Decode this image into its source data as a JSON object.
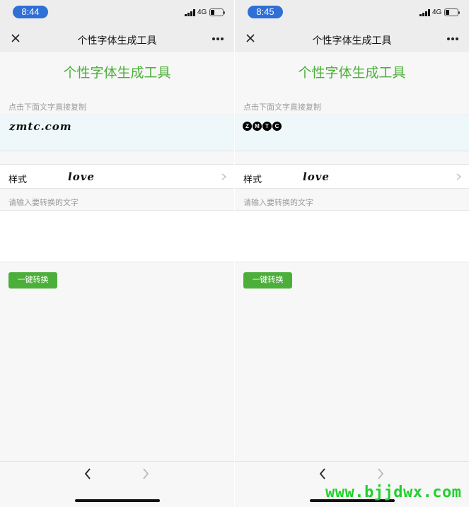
{
  "screens": {
    "left": {
      "time": "8:44",
      "network": "4G",
      "nav_title": "个性字体生成工具",
      "page_title": "个性字体生成工具",
      "copy_hint": "点击下面文字直接复制",
      "result_text": "zmtc.com",
      "style_label": "样式",
      "style_value": "love",
      "input_hint": "请输入要转换的文字",
      "input_value": "",
      "convert_label": "一键转换"
    },
    "right": {
      "time": "8:45",
      "network": "4G",
      "nav_title": "个性字体生成工具",
      "page_title": "个性字体生成工具",
      "copy_hint": "点击下面文字直接复制",
      "result_letters": [
        "Z",
        "M",
        "T",
        "C"
      ],
      "style_label": "样式",
      "style_value": "love",
      "input_hint": "请输入要转换的文字",
      "input_value": "",
      "convert_label": "一键转换"
    }
  },
  "watermark": "www.bjjdwx.com",
  "colors": {
    "accent_green": "#4caf3a",
    "time_pill_blue": "#2f6fd6",
    "result_bg": "#eef7f9",
    "watermark_green": "#22d12c"
  },
  "icons": [
    "close-icon",
    "more-icon",
    "chevron-right-icon",
    "back-icon",
    "forward-icon",
    "battery-icon",
    "signal-icon"
  ]
}
